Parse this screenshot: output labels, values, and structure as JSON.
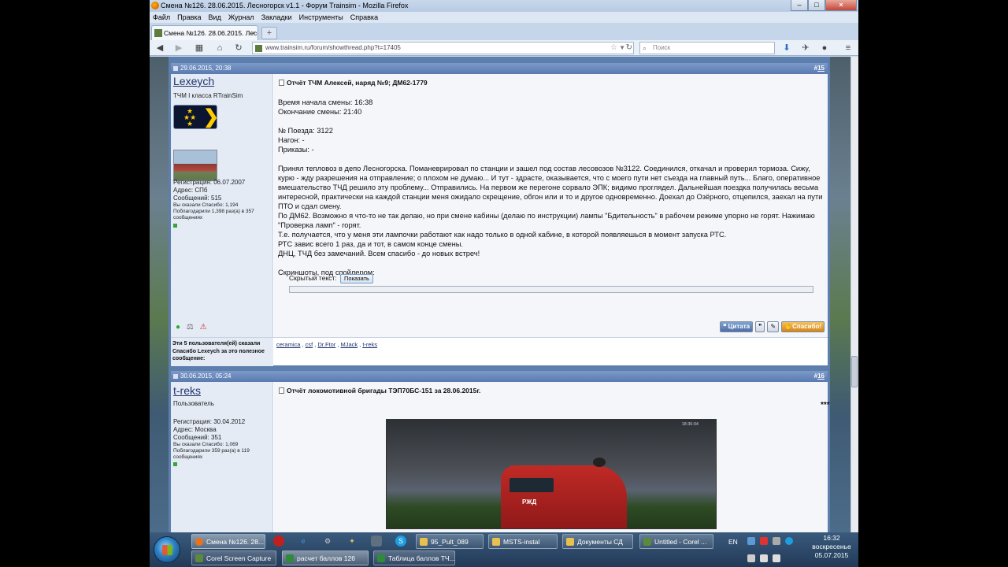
{
  "window": {
    "title": "Смена №126. 28.06.2015. Лесногорск v1.1 - Форум Trainsim - Mozilla Firefox",
    "menu": [
      "Файл",
      "Правка",
      "Вид",
      "Журнал",
      "Закладки",
      "Инструменты",
      "Справка"
    ],
    "tab_title": "Смена №126. 28.06.2015. Лесо...",
    "tab_close": "×",
    "newtab": "+",
    "url": "www.trainsim.ru/forum/showthread.php?t=17405",
    "search_placeholder": "Поиск"
  },
  "posts": [
    {
      "date": "29.06.2015, 20:38",
      "number_prefix": "#",
      "number": "15",
      "username": "Lexeych",
      "user_title": "ТЧМ I класса RTrainSim",
      "registration": "Регистрация: 06.07.2007",
      "address": "Адрес: СПб",
      "messages": "Сообщений: 515",
      "said_thanks": "Вы сказали Спасибо: 1,194",
      "thanked": "Поблагодарили 1,398 раз(а) в 357 сообщениях",
      "title": "Отчёт ТЧМ Алексей, наряд №9; ДМ62-1779",
      "body": "Время начала смены: 16:38\nОкончание смены: 21:40\n\n№ Поезда: 3122\nНагон: -\nПриказы: -\n\nПринял тепловоз в депо Лесногорска. Поманеврировал по станции и зашел под состав лесовозов №3122. Соединился, откачал и проверил тормоза. Сижу, курю - жду разрешения на отправление; о плохом не думаю... И тут - здрасте, оказывается, что с моего пути нет съезда на главный путь... Благо, оперативное вмешательство ТЧД решило эту проблему... Отправились. На первом же перегоне сорвало ЭПК; видимо проглядел. Дальнейшая поездка получилась весьма интересной, практически на каждой станции меня ожидало скрещение, обгон или и то и другое одновременно. Доехал до Озёрного, отцепился, заехал на пути ПТО и сдал смену.\nПо ДМ62. Возможно я что-то не так делаю, но при смене кабины (делаю по инструкции) лампы \"Бдительность\" в рабочем режиме упорно не горят. Нажимаю \"Проверка ламп\" - горят.\nТ.е. получается, что у меня эти лампочки работают как надо только в одной кабине, в которой появляешься в момент запуска РТС.\nРТС завис всего 1 раз, да и тот, в самом конце смены.\nДНЦ, ТЧД без замечаний. Всем спасибо - до новых встреч!\n\nСкриншоты, под спойлером:",
      "spoiler_label": "Скрытый текст:",
      "spoiler_button": "Показать",
      "actions": {
        "quote": "Цитата",
        "thanks": "Спасибо!"
      },
      "thanks_label": "Эти 5 пользователя(ей) сказали Спасибо Lexeych за это полезное сообщение:",
      "thanked_users": [
        "ceramica",
        "csf",
        "Dr.Ftor",
        "MJack",
        "t-reks"
      ]
    },
    {
      "date": "30.06.2015, 05:24",
      "number_prefix": "#",
      "number": "16",
      "username": "t-reks",
      "user_title": "Пользователь",
      "registration": "Регистрация: 30.04.2012",
      "address": "Адрес: Москва",
      "messages": "Сообщений: 351",
      "said_thanks": "Вы сказали Спасибо: 1,069",
      "thanked": "Поблагодарили 359 раз(а) в 119 сообщениях",
      "title": "Отчёт локомотивной бригады ТЭП70БС-151 за 28.06.2015г.",
      "separator": "***",
      "screenshot_clock": "18:36:04",
      "screenshot_logo": "РЖД"
    }
  ],
  "taskbar": {
    "row1": [
      "Смена №126. 28...",
      "95_Pult_089",
      "MSTS-instal",
      "Документы СД",
      "Untitled - Corel ..."
    ],
    "row2": [
      "Corel Screen Capture",
      "расчет баллов 126",
      "Таблица баллов ТЧ..."
    ],
    "lang": "EN",
    "time": "16:32",
    "day": "воскресенье",
    "date": "05.07.2015"
  },
  "colors": {
    "accent": "#5a7bb1",
    "link": "#22336e"
  }
}
